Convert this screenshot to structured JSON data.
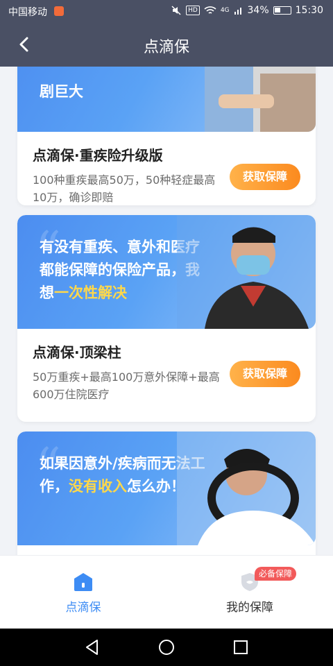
{
  "status_bar": {
    "carrier": "中国移动",
    "hd": "HD",
    "network": "4G",
    "battery": "34%",
    "time": "15:30"
  },
  "nav": {
    "title": "点滴保"
  },
  "cards": [
    {
      "banner_lines": [
        "剧巨大"
      ],
      "highlight": "",
      "title": "点滴保·重疾险升级版",
      "desc": "100种重疾最高50万，50种轻症最高10万，确诊即赔",
      "cta": "获取保障"
    },
    {
      "banner_pre": "有没有重疾、意外和医疗都能保障的保险产品，我想",
      "highlight": "一次性解决",
      "banner_post": "",
      "title": "点滴保·顶梁柱",
      "desc": "50万重疾+最高100万意外保障+最高600万住院医疗",
      "cta": "获取保障"
    },
    {
      "banner_pre": "如果因意外/疾病而无法工作，",
      "highlight": "没有收入",
      "banner_post": "怎么办！"
    }
  ],
  "tabbar": {
    "home_label": "点滴保",
    "mine_label": "我的保障",
    "mine_badge": "必备保障",
    "active_color": "#3d8cf4"
  }
}
